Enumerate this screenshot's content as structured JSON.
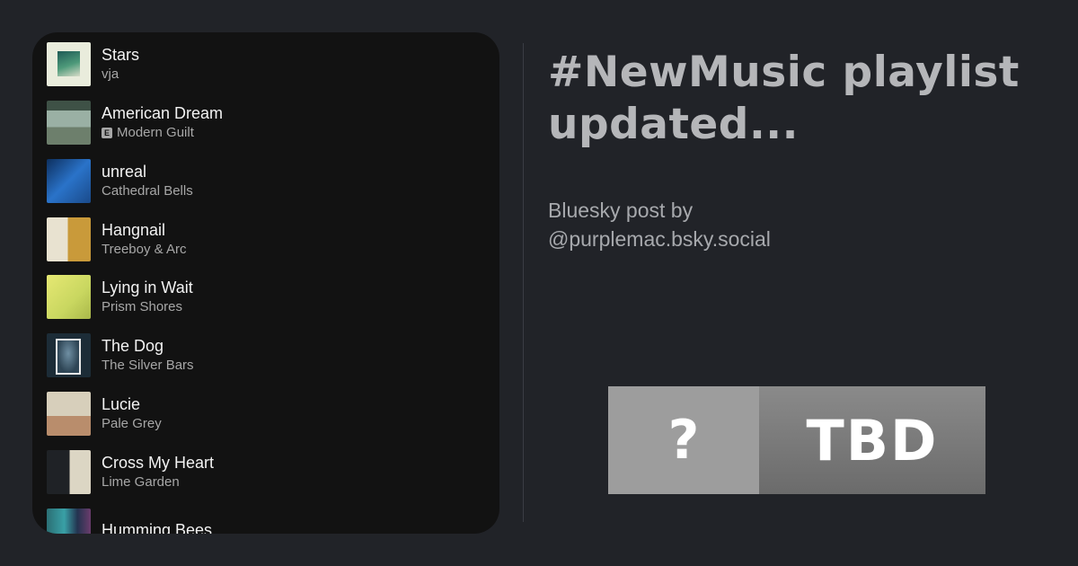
{
  "playlist": {
    "tracks": [
      {
        "title": "Stars",
        "artist": "vja",
        "explicit": false
      },
      {
        "title": "American Dream",
        "artist": "Modern Guilt",
        "explicit": true,
        "explicit_label": "E"
      },
      {
        "title": "unreal",
        "artist": "Cathedral Bells",
        "explicit": false
      },
      {
        "title": "Hangnail",
        "artist": "Treeboy & Arc",
        "explicit": false
      },
      {
        "title": "Lying in Wait",
        "artist": "Prism Shores",
        "explicit": false
      },
      {
        "title": "The Dog",
        "artist": "The Silver Bars",
        "explicit": false
      },
      {
        "title": "Lucie",
        "artist": "Pale Grey",
        "explicit": false
      },
      {
        "title": "Cross My Heart",
        "artist": "Lime Garden",
        "explicit": false
      },
      {
        "title": "Humming Bees",
        "artist": "",
        "explicit": false
      }
    ]
  },
  "post": {
    "title_line1": "#NewMusic playlist",
    "title_line2": "updated...",
    "byline_line1": "Bluesky post by",
    "byline_line2": "@purplemac.bsky.social"
  },
  "badge": {
    "left": "?",
    "right": "TBD"
  },
  "colors": {
    "background": "#212328",
    "panel": "#121212",
    "track_title": "#f2f2f2",
    "track_artist": "#a7a7a7",
    "heading": "#b5b6b9",
    "badge_left": "#9d9d9d",
    "badge_right": "#7a7a7a"
  }
}
